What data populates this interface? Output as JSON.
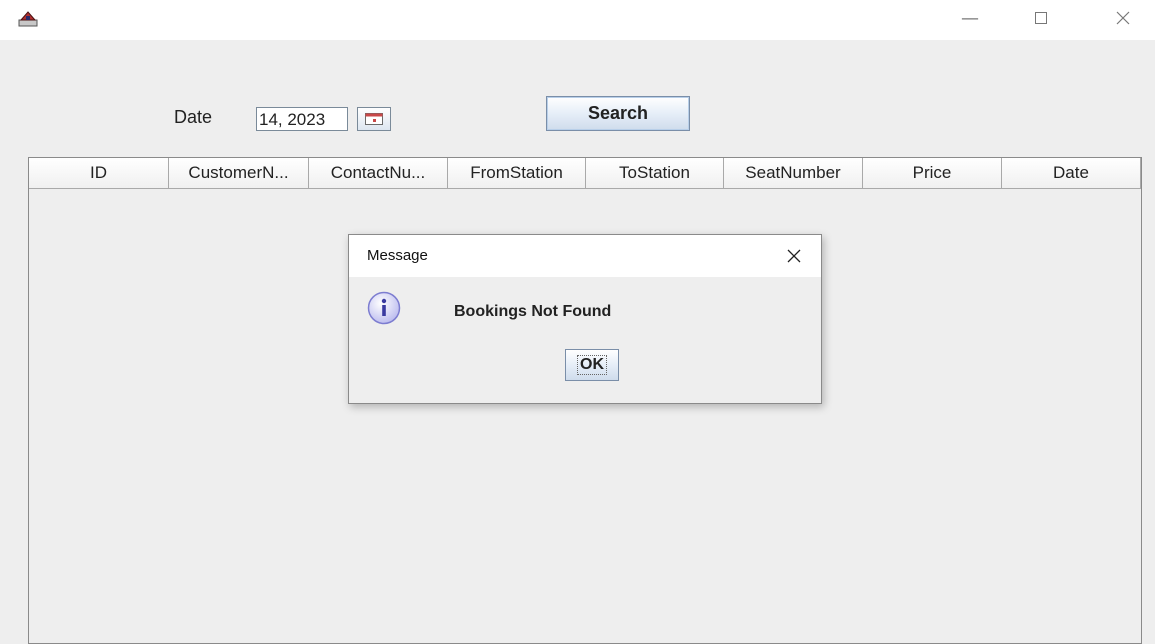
{
  "window": {
    "app_icon": "java-app-icon",
    "controls": {
      "minimize": "minimize-icon",
      "maximize": "maximize-icon",
      "close": "close-icon"
    }
  },
  "form": {
    "date_label": "Date",
    "date_value": "14, 2023",
    "calendar_icon": "calendar-icon",
    "search_label": "Search"
  },
  "table": {
    "columns": [
      "ID",
      "CustomerN...",
      "ContactNu...",
      "FromStation",
      "ToStation",
      "SeatNumber",
      "Price",
      "Date"
    ],
    "rows": []
  },
  "dialog": {
    "title": "Message",
    "icon": "info-icon",
    "message": "Bookings Not Found",
    "ok_label": "OK"
  },
  "colors": {
    "background": "#eeeeee",
    "button_border": "#7a8ea8",
    "info_icon": "#9a9ae0"
  }
}
